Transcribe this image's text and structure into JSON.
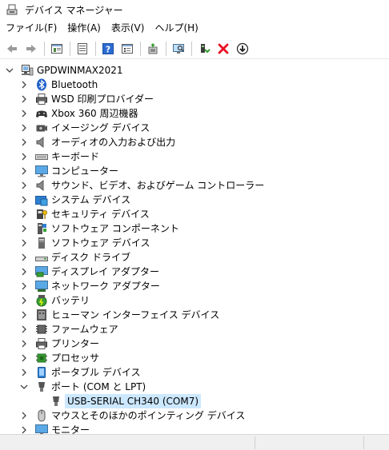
{
  "window": {
    "title": "デバイス マネージャー"
  },
  "menu": [
    {
      "label": "ファイル(F)"
    },
    {
      "label": "操作(A)"
    },
    {
      "label": "表示(V)"
    },
    {
      "label": "ヘルプ(H)"
    }
  ],
  "toolbar": {
    "buttons": [
      "back-arrow-icon",
      "forward-arrow-icon",
      "show-hide-tree-icon",
      "properties-icon",
      "help-icon",
      "view-icon",
      "update-driver-icon",
      "scan-hardware-icon",
      "enable-device-icon",
      "uninstall-device-icon",
      "disable-device-icon"
    ]
  },
  "tree": {
    "root": {
      "label": "GPDWINMAX2021",
      "expanded": true
    },
    "categories": [
      {
        "label": "Bluetooth",
        "icon": "bluetooth-icon"
      },
      {
        "label": "WSD 印刷プロバイダー",
        "icon": "printer-wsd-icon"
      },
      {
        "label": "Xbox 360 周辺機器",
        "icon": "gamepad-icon"
      },
      {
        "label": "イメージング デバイス",
        "icon": "camera-icon"
      },
      {
        "label": "オーディオの入力および出力",
        "icon": "speaker-icon"
      },
      {
        "label": "キーボード",
        "icon": "keyboard-icon"
      },
      {
        "label": "コンピューター",
        "icon": "monitor-icon"
      },
      {
        "label": "サウンド、ビデオ、およびゲーム コントローラー",
        "icon": "sound-icon"
      },
      {
        "label": "システム デバイス",
        "icon": "system-folder-icon"
      },
      {
        "label": "セキュリティ デバイス",
        "icon": "security-key-icon"
      },
      {
        "label": "ソフトウェア コンポーネント",
        "icon": "software-component-icon"
      },
      {
        "label": "ソフトウェア デバイス",
        "icon": "software-device-icon"
      },
      {
        "label": "ディスク ドライブ",
        "icon": "disk-drive-icon"
      },
      {
        "label": "ディスプレイ アダプター",
        "icon": "display-adapter-icon"
      },
      {
        "label": "ネットワーク アダプター",
        "icon": "network-adapter-icon"
      },
      {
        "label": "バッテリ",
        "icon": "battery-icon"
      },
      {
        "label": "ヒューマン インターフェイス デバイス",
        "icon": "hid-icon"
      },
      {
        "label": "ファームウェア",
        "icon": "firmware-icon"
      },
      {
        "label": "プリンター",
        "icon": "printer-icon"
      },
      {
        "label": "プロセッサ",
        "icon": "processor-icon"
      },
      {
        "label": "ポータブル デバイス",
        "icon": "portable-device-icon"
      },
      {
        "label": "ポート (COM と LPT)",
        "icon": "port-icon",
        "expanded": true
      },
      {
        "label": "USB-SERIAL CH340 (COM7)",
        "icon": "serial-port-icon",
        "child": true,
        "selected": true
      },
      {
        "label": "マウスとそのほかのポインティング デバイス",
        "icon": "mouse-icon"
      },
      {
        "label": "モニター",
        "icon": "monitor-icon"
      }
    ]
  },
  "colors": {
    "selection": "#cce8ff",
    "accent": "#0078d7",
    "danger": "#e81123"
  }
}
